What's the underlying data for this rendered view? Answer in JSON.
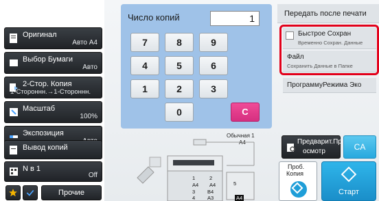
{
  "left_panel": {
    "buttons": [
      {
        "label": "Оригинал",
        "value": "Авто      A4"
      },
      {
        "label": "Выбор Бумаги",
        "value": "Авто"
      },
      {
        "label": "2-Стор. Копия",
        "value": "1-Стороннн.→1-Стороннн."
      },
      {
        "label": "Масштаб",
        "value": "100%"
      },
      {
        "label": "Экспозиция",
        "value": "Авто"
      },
      {
        "label": "Вывод копий",
        "value": ""
      },
      {
        "label": "N в 1",
        "value": "Off"
      }
    ],
    "bottom": {
      "prev_label": "Прочие"
    }
  },
  "keypad": {
    "copies_label": "Число копий",
    "copies_value": "1",
    "keys": [
      "7",
      "8",
      "9",
      "4",
      "5",
      "6",
      "1",
      "2",
      "3",
      "0"
    ],
    "clear_label": "C"
  },
  "machine": {
    "output_label": "Обычная 1",
    "output_size": "A4",
    "trays": {
      "t1": "1",
      "t1_size": "A4",
      "t2": "2",
      "t2_size": "A4",
      "t3": "3",
      "t3_size": "B4",
      "t4": "4",
      "t4_size": "A3",
      "t5": "5",
      "t5_size": "A4"
    }
  },
  "right_panel": {
    "send_after_print": "Передать после печати",
    "quick_save": {
      "title": "Быстрое Сохран",
      "subtitle": "Временно Сохран. Данные"
    },
    "file": {
      "title": "Файл",
      "subtitle": "Сохранить Данные в Папке"
    },
    "eco": "ПрограммуРежима Эко",
    "preview_label": "Предварит.Просмотр",
    "preview_label_line1": "Предварит.Пр",
    "preview_label_line2": "осмотр",
    "ca_label": "CA",
    "proof_label_line1": "Проб.",
    "proof_label_line2": "Копия",
    "start_label": "Старт"
  },
  "colors": {
    "keypad_bg": "#9fc2e8",
    "highlight": "#e2001a",
    "start": "#1a8ec9",
    "clear_key": "#e0398a"
  }
}
